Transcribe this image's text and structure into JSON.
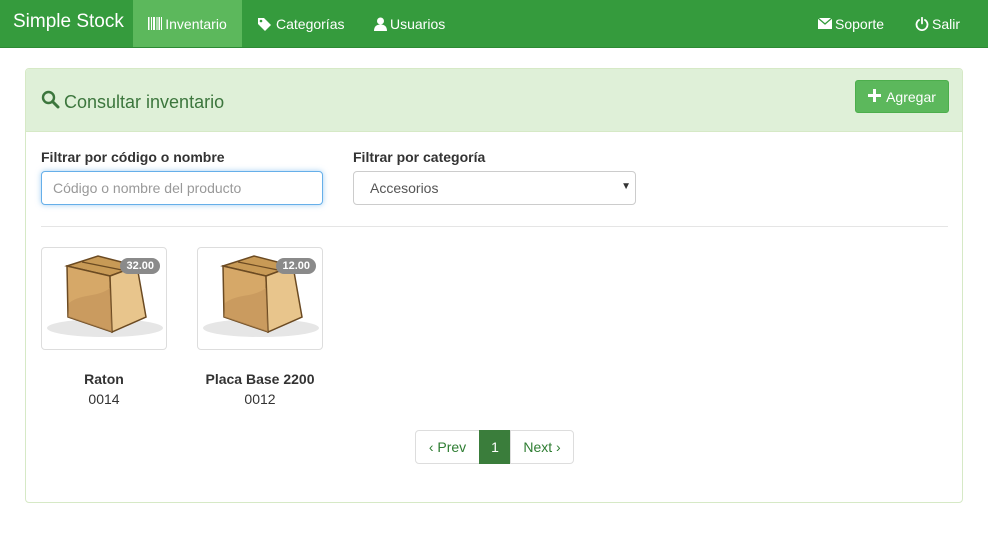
{
  "navbar": {
    "brand": "Simple Stock",
    "items": [
      {
        "label": "Inventario",
        "icon": "barcode-icon"
      },
      {
        "label": "Categorías",
        "icon": "tags-icon"
      },
      {
        "label": "Usuarios",
        "icon": "user-icon"
      }
    ],
    "right": [
      {
        "label": "Soporte",
        "icon": "envelope-icon"
      },
      {
        "label": "Salir",
        "icon": "power-icon"
      }
    ]
  },
  "panel": {
    "title": "Consultar inventario",
    "add_button": "Agregar"
  },
  "filters": {
    "search_label": "Filtrar por código o nombre",
    "search_placeholder": "Código o nombre del producto",
    "search_value": "",
    "category_label": "Filtrar por categoría",
    "category_selected": "Accesorios"
  },
  "products": [
    {
      "name": "Raton",
      "code": "0014",
      "price": "32.00"
    },
    {
      "name": "Placa Base 2200",
      "code": "0012",
      "price": "12.00"
    }
  ],
  "pagination": {
    "prev": "‹ Prev",
    "current": "1",
    "next": "Next ›"
  },
  "colors": {
    "navbar": "#359b3d",
    "navbar_active": "#5cb85c",
    "panel_heading": "#dff0d8",
    "title_text": "#3c763d",
    "success_button": "#5cb85c",
    "badge": "#8a8a8a",
    "page_active": "#3a7d3b"
  }
}
